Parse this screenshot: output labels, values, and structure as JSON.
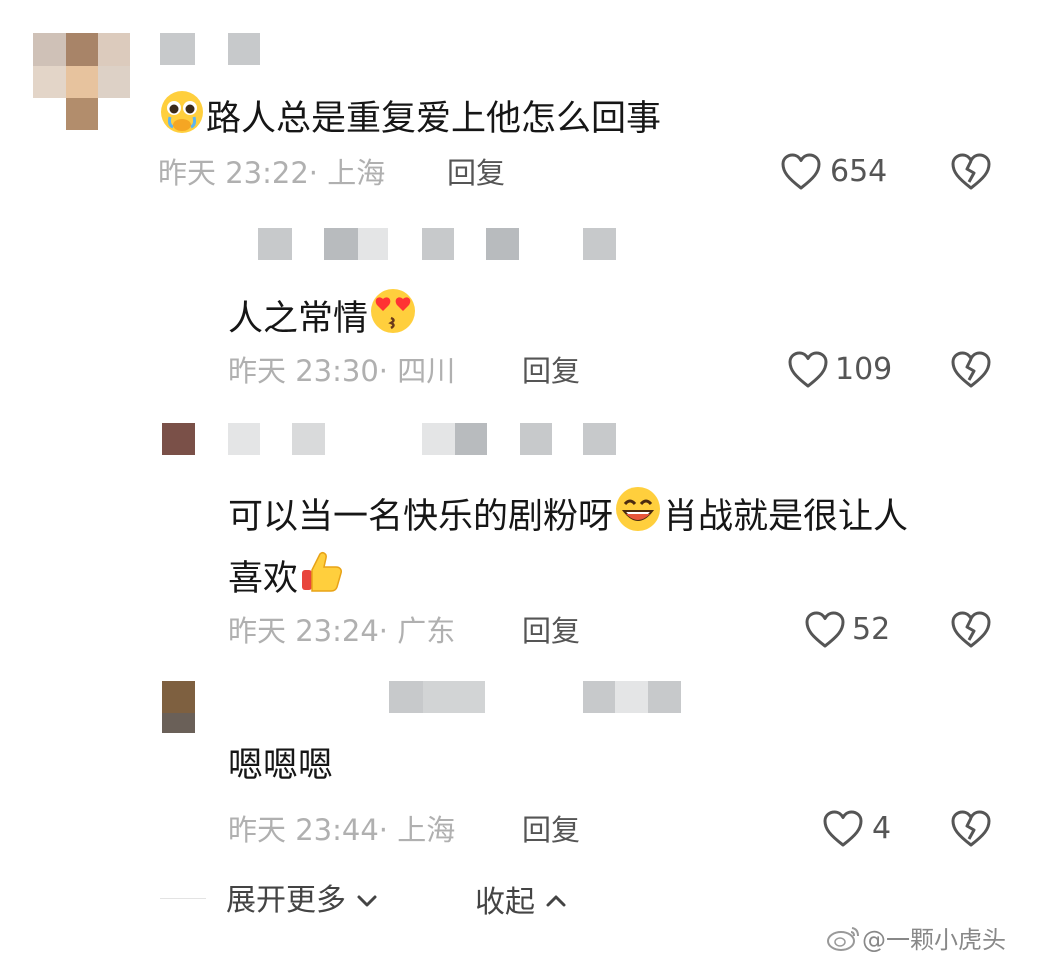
{
  "comments": [
    {
      "text": "路人总是重复爱上他怎么回事",
      "emoji": "pleading-face",
      "time": "昨天 23:22",
      "location": "· 上海",
      "reply_label": "回复",
      "likes": "654"
    },
    {
      "text": "人之常情",
      "emoji": "heart-eyes-kiss-face",
      "time": "昨天 23:30",
      "location": "· 四川",
      "reply_label": "回复",
      "likes": "109"
    },
    {
      "text_line1": "可以当一名快乐的剧粉呀",
      "text_line1_tail": "肖战就是很让人",
      "text_line2": "喜欢",
      "emoji1": "grinning-face",
      "emoji2": "thumbs-up",
      "time": "昨天 23:24",
      "location": "· 广东",
      "reply_label": "回复",
      "likes": "52"
    },
    {
      "text": "嗯嗯嗯",
      "time": "昨天 23:44",
      "location": "· 上海",
      "reply_label": "回复",
      "likes": "4"
    }
  ],
  "footer": {
    "expand_label": "展开更多",
    "collapse_label": "收起"
  },
  "watermark": "@一颗小虎头",
  "colors": {
    "text": "#161616",
    "meta": "#b0b0b0",
    "action": "#555555"
  }
}
